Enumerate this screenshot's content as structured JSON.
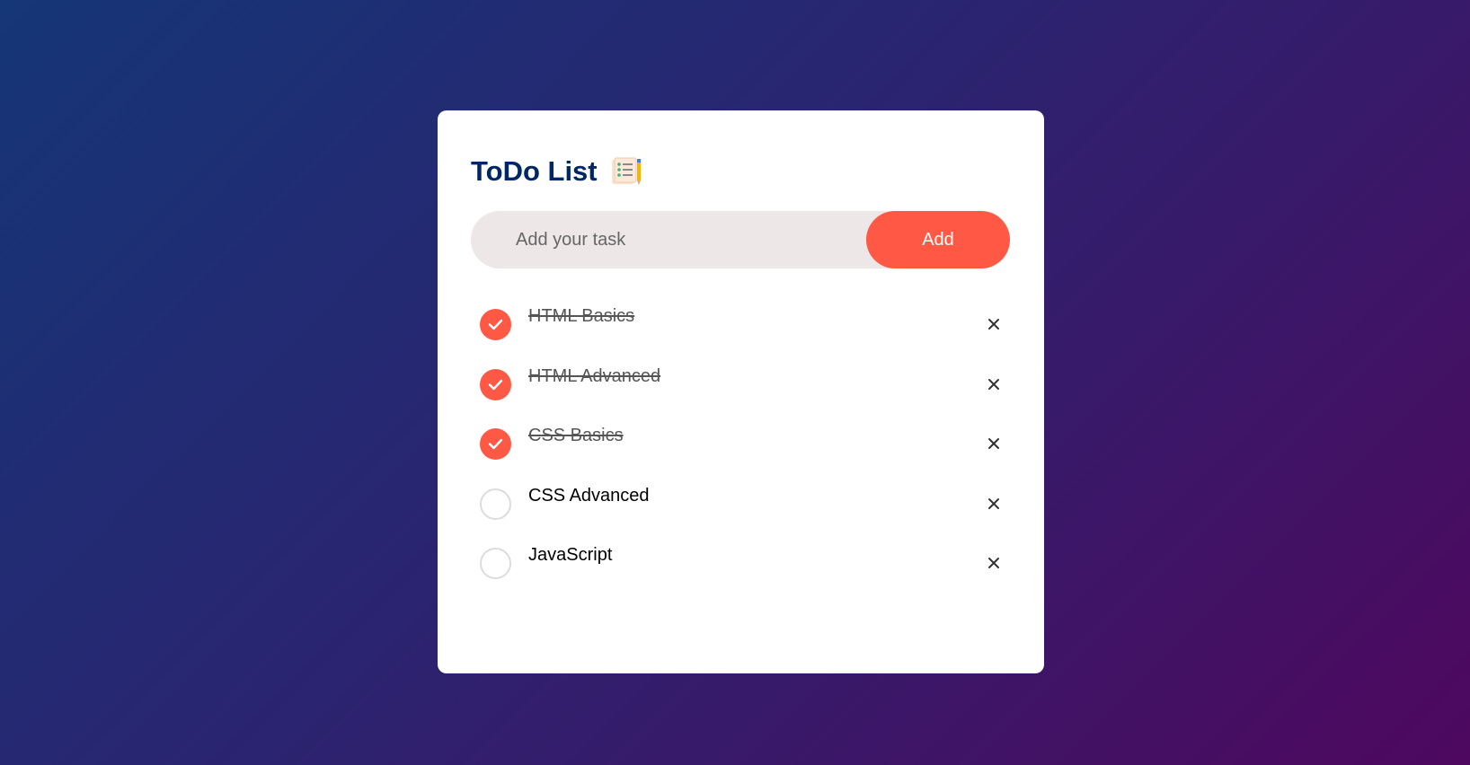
{
  "app": {
    "title": "ToDo List",
    "title_icon": "notepad-checklist-icon"
  },
  "colors": {
    "accent": "#ff5945",
    "title": "#002765",
    "input_bg": "#ede7e7",
    "bg_start": "#153677",
    "bg_end": "#4e085f"
  },
  "input": {
    "placeholder": "Add your task",
    "value": ""
  },
  "add_button": {
    "label": "Add"
  },
  "tasks": [
    {
      "label": "HTML Basics",
      "done": true
    },
    {
      "label": "HTML Advanced",
      "done": true
    },
    {
      "label": "CSS Basics",
      "done": true
    },
    {
      "label": "CSS Advanced",
      "done": false
    },
    {
      "label": "JavaScript",
      "done": false
    }
  ],
  "icons": {
    "check": "checkmark-icon",
    "delete": "close-icon"
  }
}
